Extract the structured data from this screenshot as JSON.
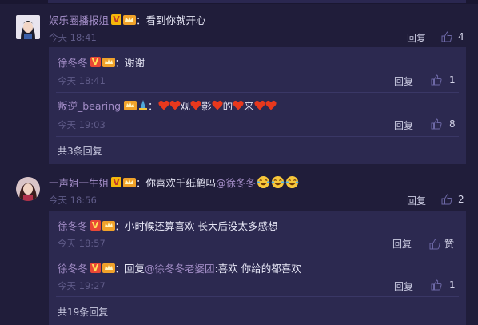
{
  "comments": [
    {
      "user": "娱乐圈播报姐",
      "text": "看到你就开心",
      "time": "今天 18:41",
      "reply_label": "回复",
      "likes": "4",
      "replies": [
        {
          "user": "徐冬冬",
          "text": "谢谢",
          "time": "今天 18:41",
          "reply_label": "回复",
          "likes": "1"
        },
        {
          "user": "叛逆_bearing",
          "text_parts": [
            "观",
            "影",
            "的",
            "来"
          ],
          "time": "今天 19:03",
          "reply_label": "回复",
          "likes": "8"
        }
      ],
      "more_label": "共3条回复"
    },
    {
      "user": "一声姐一生姐",
      "text": "你喜欢千纸鹤吗",
      "mention": "@徐冬冬",
      "time": "今天 18:56",
      "reply_label": "回复",
      "likes": "2",
      "replies": [
        {
          "user": "徐冬冬",
          "text": "小时候还算喜欢 长大后没太多感想",
          "time": "今天 18:57",
          "reply_label": "回复",
          "likes": "赞"
        },
        {
          "user": "徐冬冬",
          "reply_prefix": "回复",
          "mention": "@徐冬冬老婆团",
          "text": ":喜欢 你给的都喜欢",
          "time": "今天 19:27",
          "reply_label": "回复",
          "likes": "1"
        }
      ],
      "more_label": "共19条回复"
    }
  ],
  "colon": "：",
  "badges": {
    "v": "V"
  },
  "colors": {
    "background": "#201d3a",
    "reply_box": "#2c2950",
    "username": "#a48ec8",
    "time": "#5f5b88",
    "heart": "#e8381d"
  },
  "icons": [
    "thumb-up-icon",
    "heart-icon",
    "laugh-cry-emoji-icon",
    "crown-badge-icon",
    "verified-v-icon"
  ]
}
